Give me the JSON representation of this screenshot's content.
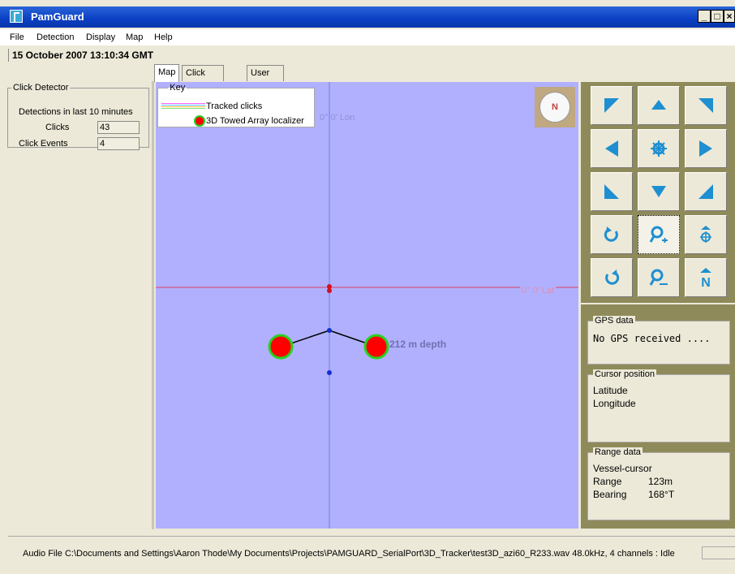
{
  "window": {
    "title": "PamGuard",
    "buttons": [
      "_",
      "□",
      "×"
    ]
  },
  "menu": [
    "File",
    "Detection",
    "Display",
    "Map",
    "Help"
  ],
  "datetime": "15 October 2007 13:10:34 GMT",
  "click_detector_panel": {
    "title": "Click Detector",
    "subtitle": "Detections in last 10 minutes",
    "clicks_label": "Clicks",
    "clicks_value": "43",
    "events_label": "Click Events",
    "events_value": "4"
  },
  "tabs": [
    "Map",
    "Click Detector",
    "User Display panel"
  ],
  "key": {
    "title": "Key",
    "tracked_clicks": "Tracked clicks",
    "localizer": "3D Towed Array localizer"
  },
  "map": {
    "lon_label": "0° 0' Lon",
    "lat_label": "0° 0' Lat",
    "depth_label": "212 m depth",
    "compass_letter": "N",
    "background_color": "#b0b0ff"
  },
  "nav_icons": [
    "arrow-up-left-icon",
    "arrow-up-icon",
    "arrow-up-right-icon",
    "arrow-left-icon",
    "center-ship-icon",
    "arrow-right-icon",
    "arrow-down-left-icon",
    "arrow-down-icon",
    "arrow-down-right-icon",
    "rotate-clockwise-icon",
    "zoom-in-icon",
    "ship-up-icon",
    "rotate-counterclockwise-icon",
    "zoom-out-icon",
    "north-up-icon"
  ],
  "gps": {
    "title": "GPS data",
    "text": "No GPS received ...."
  },
  "cursor": {
    "title": "Cursor position",
    "lat_label": "Latitude",
    "lon_label": "Longitude"
  },
  "range": {
    "title": "Range data",
    "vessel_cursor": "Vessel-cursor",
    "range_label": "Range",
    "range_value": "123m",
    "bearing_label": "Bearing",
    "bearing_value": "168°T"
  },
  "status": "Audio File C:\\Documents and Settings\\Aaron Thode\\My Documents\\Projects\\PAMGUARD_SerialPort\\3D_Tracker\\test3D_azi60_R233.wav 48.0kHz, 4 channels : Idle"
}
